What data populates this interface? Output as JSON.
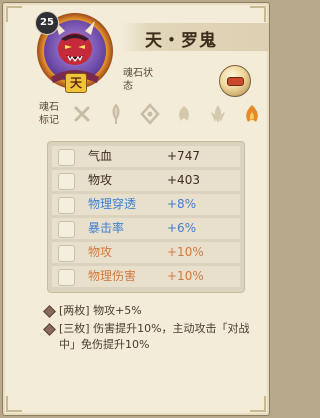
{
  "character": {
    "level": "25",
    "name": "天・罗鬼",
    "grade_tag": "天"
  },
  "soul_status_label": "魂石状态",
  "soul_mark_label": "魂石标记",
  "mark_icons": [
    "cross-mark-icon",
    "quill-icon",
    "diamond-mark-icon",
    "flame-swirl-icon",
    "petal-flame-icon",
    "fire-icon"
  ],
  "attributes": [
    {
      "name": "气血",
      "value": "+747",
      "color": "#3a2c22",
      "icon": "heart-icon"
    },
    {
      "name": "物攻",
      "value": "+403",
      "color": "#3a2c22",
      "icon": "sword-icon"
    },
    {
      "name": "物理穿透",
      "value": "+8%",
      "color": "#3d7fd0",
      "icon": "pierce-icon"
    },
    {
      "name": "暴击率",
      "value": "+6%",
      "color": "#3d7fd0",
      "icon": "crit-icon"
    },
    {
      "name": "物攻",
      "value": "+10%",
      "color": "#d07a3e",
      "icon": "sword-icon"
    },
    {
      "name": "物理伤害",
      "value": "+10%",
      "color": "#d07a3e",
      "icon": "damage-icon"
    }
  ],
  "set_bonus": {
    "two": "[两枚] 物攻+5%",
    "three": "[三枚] 伤害提升10%，主动攻击「对战中」免伤提升10%"
  }
}
